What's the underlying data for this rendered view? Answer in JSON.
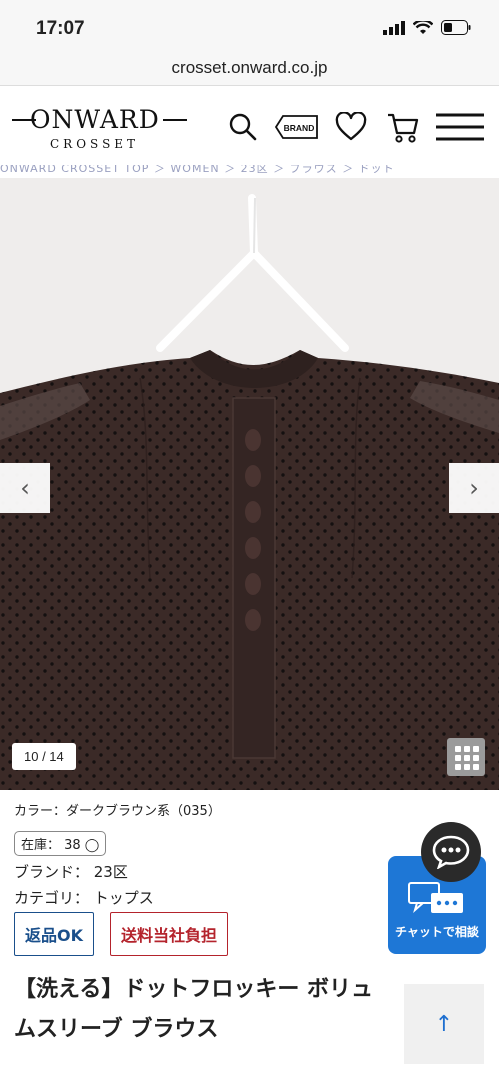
{
  "status_bar": {
    "time": "17:07"
  },
  "browser": {
    "url": "crosset.onward.co.jp"
  },
  "header": {
    "logo_main": "ONWARD",
    "logo_sub": "CROSSET",
    "brand_badge": "BRAND",
    "icons": [
      "search-icon",
      "brand-icon",
      "heart-icon",
      "cart-icon",
      "menu-icon"
    ]
  },
  "breadcrumb": "ONWARD CROSSET TOP ＞ WOMEN ＞ 23区 ＞ ブラウス ＞ ドット",
  "gallery": {
    "counter": "10 / 14",
    "prev": "‹",
    "next": "›"
  },
  "product": {
    "color": "カラー：ダークブラウン系（035）",
    "stock": "在庫： 38 ◯",
    "brand": "ブランド： 23区",
    "category": "カテゴリ： トップス",
    "tag_return": "返品OK",
    "tag_shipping": "送料当社負担",
    "title_line1": "【洗える】ドットフロッキー ボリュ",
    "title_line2": "ムスリーブ ブラウス"
  },
  "chat": {
    "label": "チャットで相談"
  },
  "to_top": "↑",
  "colors": {
    "accent_blue": "#1e77d6",
    "return_blue": "#1a4f8b",
    "ship_red": "#b4232c",
    "blouse": "#3b2a27"
  }
}
